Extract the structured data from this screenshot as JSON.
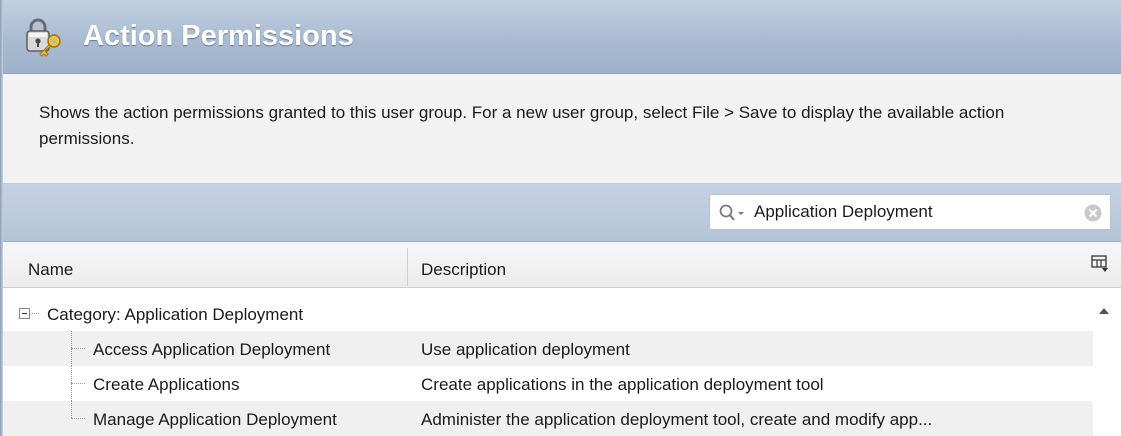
{
  "header": {
    "title": "Action Permissions",
    "icon": "lock-key-icon"
  },
  "description": {
    "text": "Shows the action permissions granted to this user group. For a new user group, select File > Save to display the available action permissions."
  },
  "filter": {
    "value": "Application Deployment",
    "placeholder": ""
  },
  "table": {
    "columns": [
      "Name",
      "Description"
    ],
    "category": "Category: Application Deployment",
    "rows": [
      {
        "name": "Access Application Deployment",
        "description": "Use application deployment"
      },
      {
        "name": "Create Applications",
        "description": "Create applications in the application deployment tool"
      },
      {
        "name": "Manage Application Deployment",
        "description": "Administer the application deployment tool, create and modify app..."
      }
    ]
  },
  "colors": {
    "header_gradient": "#a9bbd2",
    "header_title": "#ffffff",
    "row_alt": "#f0f0f0"
  }
}
